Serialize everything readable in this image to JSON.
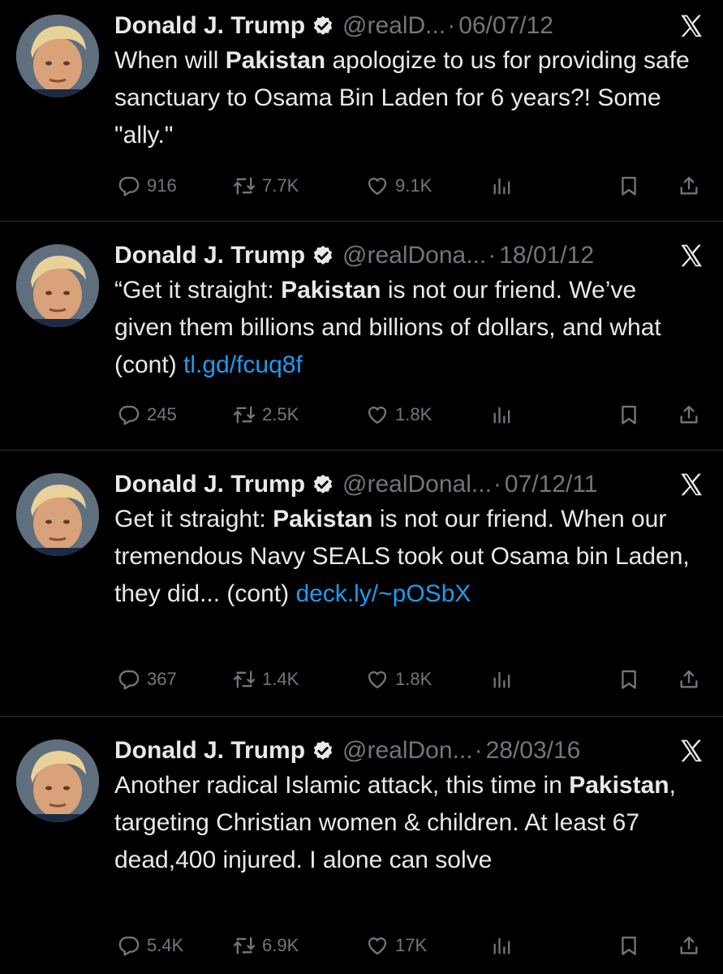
{
  "colors": {
    "background": "#000000",
    "text": "#e7e9ea",
    "muted": "#71767b",
    "link": "#1d9bf0",
    "verified": "#e7e9ea"
  },
  "tweets": [
    {
      "name": "Donald J. Trump",
      "handle": "@realD...",
      "separator": "·",
      "date": "06/07/12",
      "text_parts": [
        {
          "t": "When will ",
          "style": "normal"
        },
        {
          "t": "Pakistan",
          "style": "bold"
        },
        {
          "t": " apologize to us for providing safe sanctuary to Osama Bin Laden for 6 years?! Some \"ally.\"",
          "style": "normal"
        }
      ],
      "replies": "916",
      "retweets": "7.7K",
      "likes": "9.1K"
    },
    {
      "name": "Donald J. Trump",
      "handle": "@realDona...",
      "separator": "·",
      "date": "18/01/12",
      "text_parts": [
        {
          "t": "“Get it straight: ",
          "style": "normal"
        },
        {
          "t": "Pakistan",
          "style": "bold"
        },
        {
          "t": " is not our friend. We’ve given them billions and billions of dollars, and what (cont) ",
          "style": "normal"
        },
        {
          "t": "tl.gd/fcuq8f",
          "style": "link"
        }
      ],
      "replies": "245",
      "retweets": "2.5K",
      "likes": "1.8K"
    },
    {
      "name": "Donald J. Trump",
      "handle": "@realDonal...",
      "separator": "·",
      "date": "07/12/11",
      "text_parts": [
        {
          "t": "Get it straight: ",
          "style": "normal"
        },
        {
          "t": "Pakistan",
          "style": "bold"
        },
        {
          "t": " is not our friend. When our tremendous Navy SEALS took out Osama bin Laden, they did... (cont) ",
          "style": "normal"
        },
        {
          "t": "deck.ly/~pOSbX",
          "style": "link"
        }
      ],
      "replies": "367",
      "retweets": "1.4K",
      "likes": "1.8K"
    },
    {
      "name": "Donald J. Trump",
      "handle": "@realDon...",
      "separator": "·",
      "date": "28/03/16",
      "text_parts": [
        {
          "t": "Another radical Islamic attack, this time in ",
          "style": "normal"
        },
        {
          "t": "Pakistan",
          "style": "bold"
        },
        {
          "t": ", targeting Christian women & children. At least 67 dead,400 injured. I alone can solve",
          "style": "normal"
        }
      ],
      "replies": "5.4K",
      "retweets": "6.9K",
      "likes": "17K"
    }
  ],
  "icons": {
    "verified": "verified-badge-icon",
    "platform": "x-logo-icon",
    "reply": "reply-icon",
    "retweet": "retweet-icon",
    "like": "heart-icon",
    "views": "views-icon",
    "bookmark": "bookmark-icon",
    "share": "share-icon"
  }
}
